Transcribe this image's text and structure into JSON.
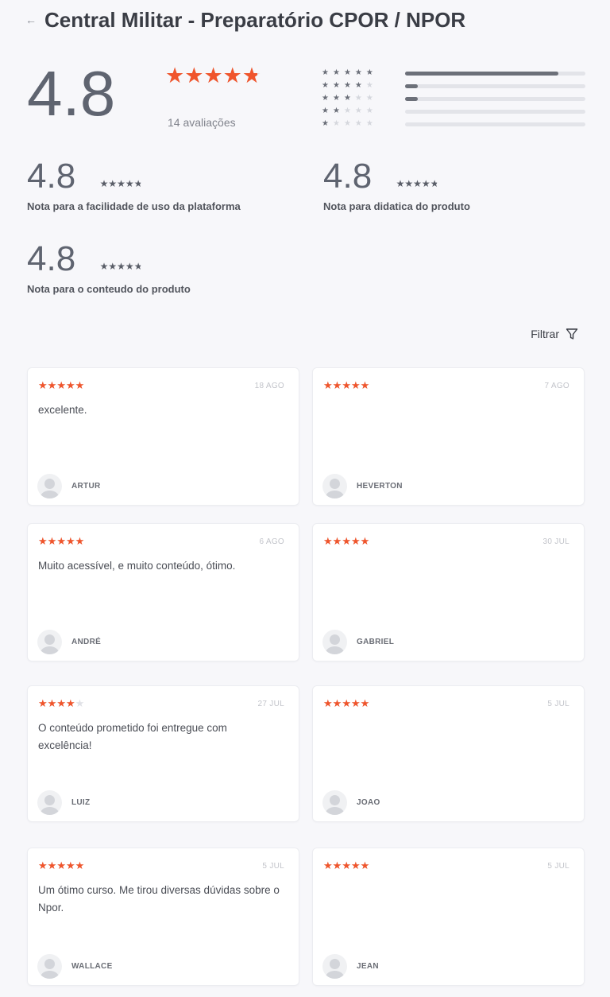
{
  "header": {
    "back_icon": "←",
    "title": "Central Militar - Preparatório CPOR / NPOR"
  },
  "summary": {
    "rating": "4.8",
    "stars_value": 4.8,
    "count_label": "14 avaliações",
    "distribution": [
      {
        "stars": 5,
        "fraction": 0.85
      },
      {
        "stars": 4,
        "fraction": 0.07
      },
      {
        "stars": 3,
        "fraction": 0.07
      },
      {
        "stars": 2,
        "fraction": 0
      },
      {
        "stars": 1,
        "fraction": 0
      }
    ]
  },
  "sub_ratings": [
    {
      "value": "4.8",
      "stars_value": 4.8,
      "label": "Nota para a facilidade de uso da plataforma"
    },
    {
      "value": "4.8",
      "stars_value": 4.8,
      "label": "Nota para didatica do produto"
    },
    {
      "value": "4.8",
      "stars_value": 4.8,
      "label": "Nota para o conteudo do produto"
    }
  ],
  "filter": {
    "label": "Filtrar",
    "icon": "filter-icon"
  },
  "reviews": [
    {
      "stars": 5,
      "date": "18 AGO",
      "text": "excelente.",
      "author": "ARTUR"
    },
    {
      "stars": 5,
      "date": "7 AGO",
      "text": "",
      "author": "HEVERTON"
    },
    {
      "stars": 5,
      "date": "6 AGO",
      "text": "Muito acessível, e muito conteúdo, ótimo.",
      "author": "ANDRÉ"
    },
    {
      "stars": 5,
      "date": "30 JUL",
      "text": "",
      "author": "GABRIEL"
    },
    {
      "stars": 4,
      "date": "27 JUL",
      "text": "O conteúdo prometido foi entregue com excelência!",
      "author": "LUIZ"
    },
    {
      "stars": 5,
      "date": "5 JUL",
      "text": "",
      "author": "JOAO"
    },
    {
      "stars": 5,
      "date": "5 JUL",
      "text": "Um ótimo curso. Me tirou diversas dúvidas sobre o Npor.",
      "author": "WALLACE"
    },
    {
      "stars": 5,
      "date": "5 JUL",
      "text": "",
      "author": "JEAN"
    }
  ],
  "colors": {
    "accent": "#f0552c",
    "star_empty": "#e0e1e6",
    "bar_fill": "#6c7079"
  }
}
